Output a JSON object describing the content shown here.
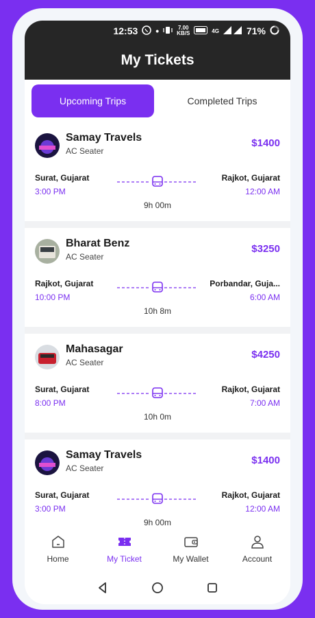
{
  "status": {
    "time": "12:53",
    "speed": "7.00",
    "speed_unit": "KB/S",
    "net": "4G",
    "battery": "71%"
  },
  "header": {
    "title": "My Tickets"
  },
  "tabs": [
    {
      "label": "Upcoming Trips",
      "active": true
    },
    {
      "label": "Completed Trips",
      "active": false
    }
  ],
  "tickets": [
    {
      "operator": "Samay Travels",
      "seat": "AC Seater",
      "price": "$1400",
      "from": "Surat, Gujarat",
      "from_time": "3:00 PM",
      "to": "Rajkot, Gujarat",
      "to_time": "12:00 AM",
      "duration": "9h 00m"
    },
    {
      "operator": "Bharat Benz",
      "seat": "AC Seater",
      "price": "$3250",
      "from": "Rajkot, Gujarat",
      "from_time": "10:00 PM",
      "to": "Porbandar, Guja...",
      "to_time": "6:00 AM",
      "duration": "10h 8m"
    },
    {
      "operator": "Mahasagar",
      "seat": "AC Seater",
      "price": "$4250",
      "from": "Surat, Gujarat",
      "from_time": "8:00 PM",
      "to": "Rajkot, Gujarat",
      "to_time": "7:00 AM",
      "duration": "10h 0m"
    },
    {
      "operator": "Samay Travels",
      "seat": "AC Seater",
      "price": "$1400",
      "from": "Surat, Gujarat",
      "from_time": "3:00 PM",
      "to": "Rajkot, Gujarat",
      "to_time": "12:00 AM",
      "duration": "9h 00m"
    }
  ],
  "nav": [
    {
      "label": "Home",
      "icon": "home-icon"
    },
    {
      "label": "My Ticket",
      "icon": "ticket-icon"
    },
    {
      "label": "My Wallet",
      "icon": "wallet-icon"
    },
    {
      "label": "Account",
      "icon": "account-icon"
    }
  ],
  "colors": {
    "accent": "#7a2ff0",
    "header": "#262626"
  }
}
